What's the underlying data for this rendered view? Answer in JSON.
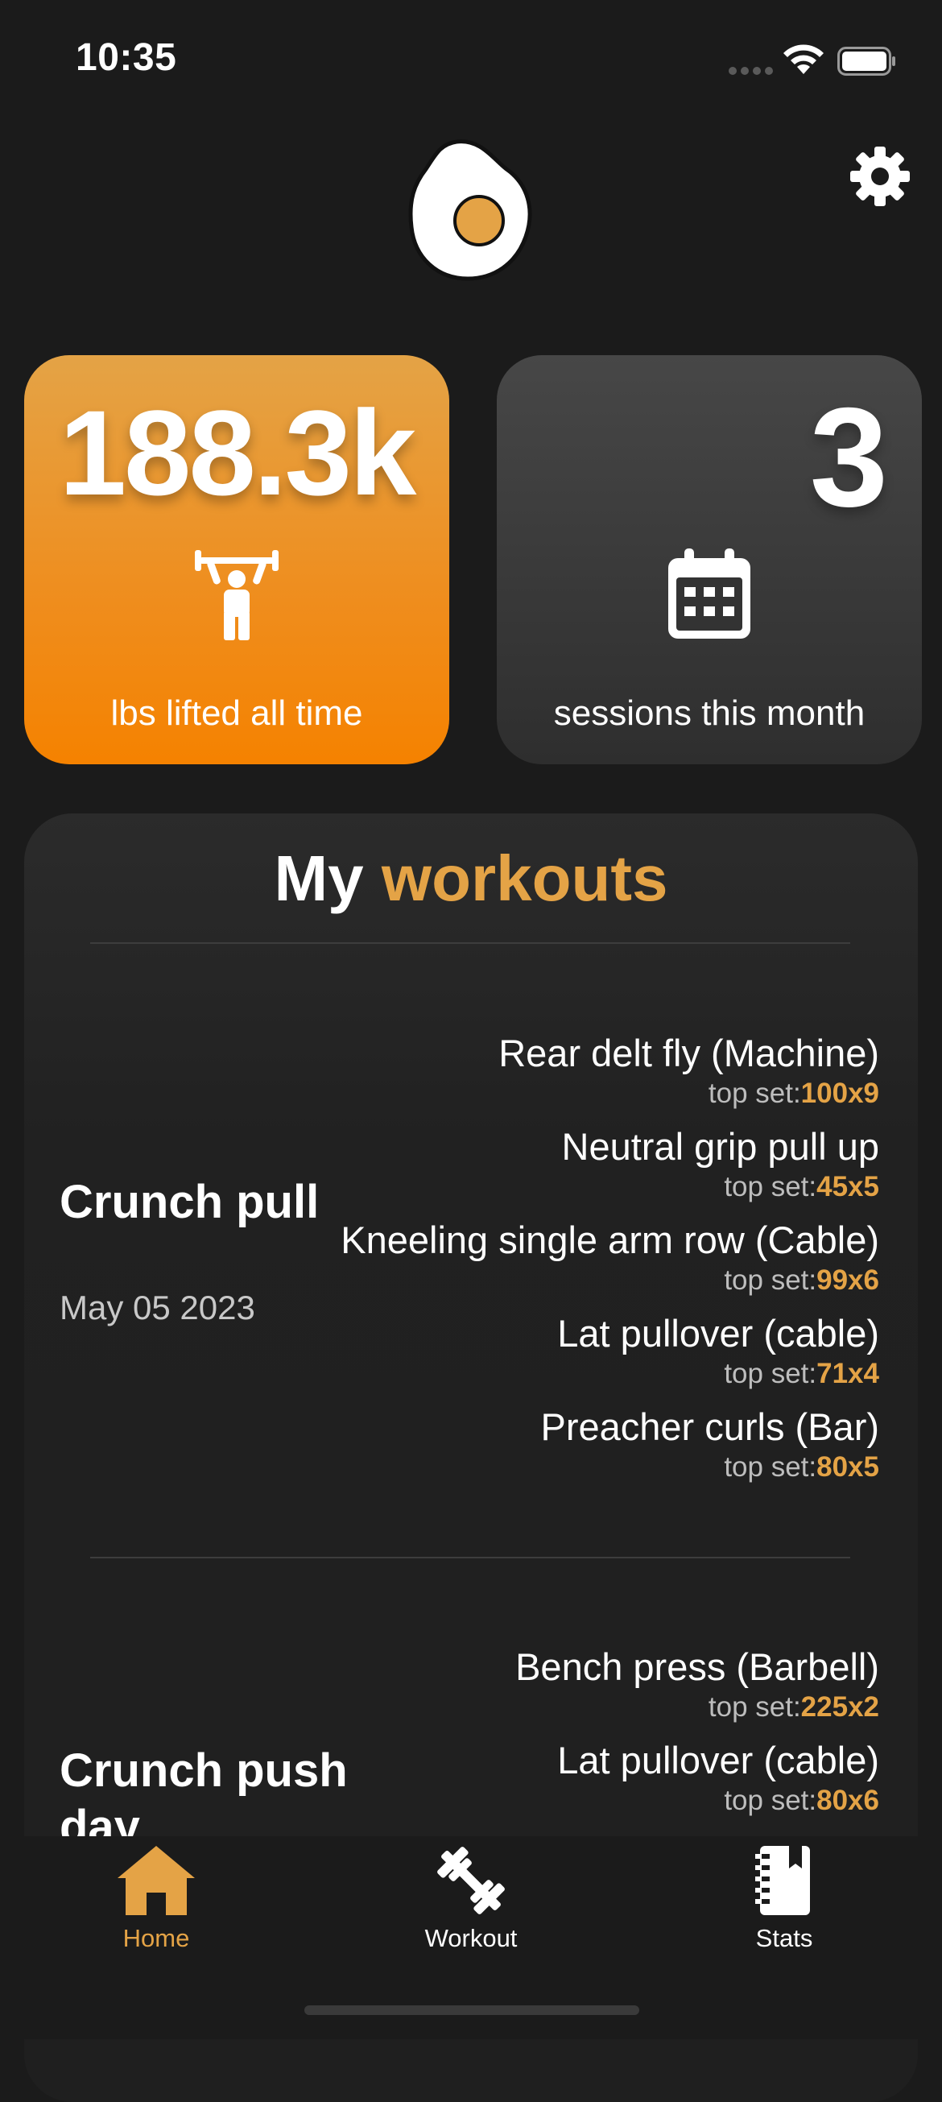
{
  "status_bar": {
    "time": "10:35"
  },
  "header": {
    "logo_icon": "fried-egg-icon",
    "settings_icon": "gear-icon"
  },
  "stats": {
    "lifted": {
      "value": "188.3k",
      "label": "lbs lifted all time",
      "icon": "weightlifter-icon"
    },
    "sessions": {
      "value": "3",
      "label": "sessions this month",
      "icon": "calendar-icon"
    }
  },
  "workouts": {
    "title_prefix": "My",
    "title_accent": "workouts",
    "top_set_label": "top set:",
    "items": [
      {
        "name": "Crunch pull",
        "date": "May 05 2023",
        "exercises": [
          {
            "name": "Rear delt fly (Machine)",
            "top_set": "100x9"
          },
          {
            "name": "Neutral grip pull up",
            "top_set": "45x5"
          },
          {
            "name": "Kneeling single arm row (Cable)",
            "top_set": "99x6"
          },
          {
            "name": "Lat pullover (cable)",
            "top_set": "71x4"
          },
          {
            "name": "Preacher curls (Bar)",
            "top_set": "80x5"
          }
        ]
      },
      {
        "name": "Crunch push day",
        "exercises": [
          {
            "name": "Bench press (Barbell)",
            "top_set": "225x2"
          },
          {
            "name": "Lat pullover (cable)",
            "top_set": "80x6"
          }
        ]
      }
    ]
  },
  "tabs": [
    {
      "label": "Home",
      "icon": "home-icon",
      "active": true
    },
    {
      "label": "Workout",
      "icon": "dumbbell-icon",
      "active": false
    },
    {
      "label": "Stats",
      "icon": "notebook-icon",
      "active": false
    }
  ],
  "colors": {
    "accent": "#e4a346",
    "card_orange": "#f58200",
    "background": "#1b1b1b"
  }
}
